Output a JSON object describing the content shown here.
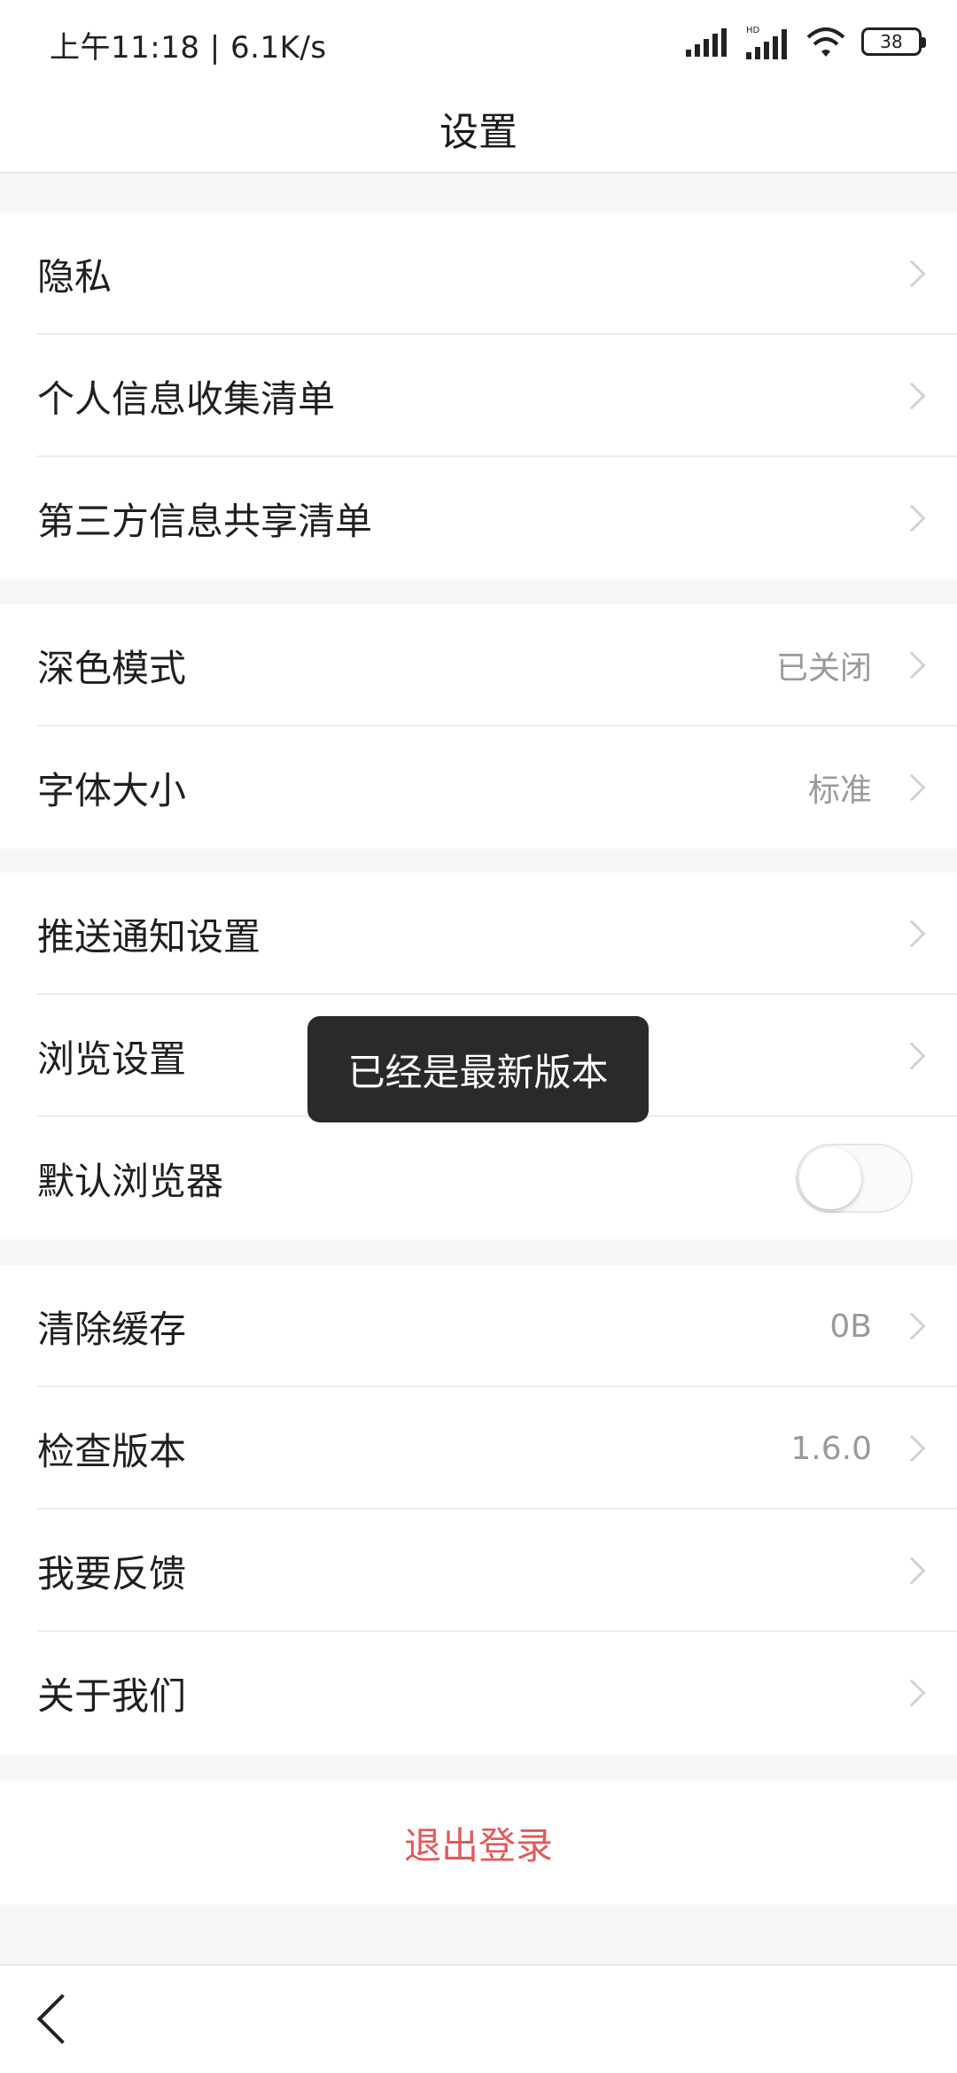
{
  "status": {
    "time": "上午11:18 | 6.1K/s",
    "battery": "38"
  },
  "header": {
    "title": "设置"
  },
  "groups": [
    [
      {
        "label": "隐私",
        "value": ""
      },
      {
        "label": "个人信息收集清单",
        "value": ""
      },
      {
        "label": "第三方信息共享清单",
        "value": ""
      }
    ],
    [
      {
        "label": "深色模式",
        "value": "已关闭"
      },
      {
        "label": "字体大小",
        "value": "标准"
      }
    ],
    [
      {
        "label": "推送通知设置",
        "value": ""
      },
      {
        "label": "浏览设置",
        "value": ""
      },
      {
        "label": "默认浏览器",
        "value": ""
      }
    ],
    [
      {
        "label": "清除缓存",
        "value": "0B"
      },
      {
        "label": "检查版本",
        "value": "1.6.0"
      },
      {
        "label": "我要反馈",
        "value": ""
      },
      {
        "label": "关于我们",
        "value": ""
      }
    ]
  ],
  "toast": {
    "text": "已经是最新版本"
  },
  "logout": {
    "label": "退出登录",
    "color": "#e05a5a"
  }
}
